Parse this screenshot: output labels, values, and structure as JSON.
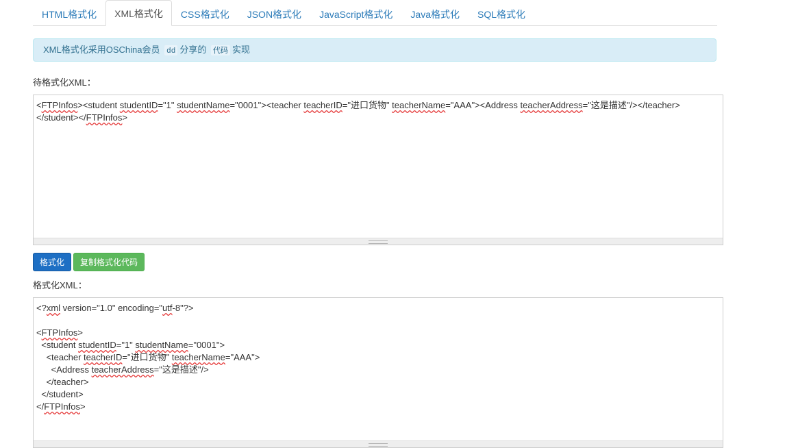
{
  "tabs": [
    {
      "label": "HTML格式化",
      "active": false
    },
    {
      "label": "XML格式化",
      "active": true
    },
    {
      "label": "CSS格式化",
      "active": false
    },
    {
      "label": "JSON格式化",
      "active": false
    },
    {
      "label": "JavaScript格式化",
      "active": false
    },
    {
      "label": "Java格式化",
      "active": false
    },
    {
      "label": "SQL格式化",
      "active": false
    }
  ],
  "notice": {
    "prefix": "XML格式化采用OSChina会员",
    "user": "dd",
    "middle": "分享的",
    "code_word": "代码",
    "suffix": "实现"
  },
  "input_section": {
    "label": "待格式化XML：",
    "value": "<FTPInfos><student studentID=\"1\" studentName=\"0001\"><teacher teacherID=\"进口货物\" teacherName=\"AAA\"><Address teacherAddress=\"这是描述\"/></teacher>\n</student></FTPInfos>"
  },
  "buttons": {
    "format": "格式化",
    "copy": "复制格式化代码"
  },
  "output_section": {
    "label": "格式化XML：",
    "value": "<?xml version=\"1.0\" encoding=\"utf-8\"?>\n\n<FTPInfos>\n  <student studentID=\"1\" studentName=\"0001\">\n    <teacher teacherID=\"进口货物\" teacherName=\"AAA\">\n      <Address teacherAddress=\"这是描述\"/>\n    </teacher>\n  </student>\n</FTPInfos>"
  },
  "colors": {
    "tab_link": "#2a7ab8",
    "alert_bg": "#d9edf7",
    "alert_text": "#31708f",
    "primary_button": "#1e6fc4",
    "success_button": "#5cb85c",
    "spellcheck": "#e53b3b"
  }
}
